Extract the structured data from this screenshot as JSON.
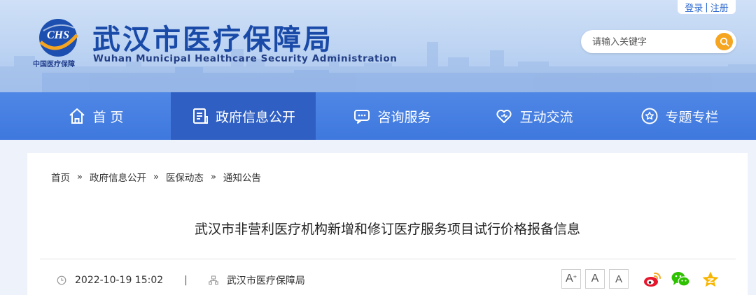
{
  "header": {
    "logo_caption": "中国医疗保障",
    "logo_text": "CHS",
    "title": "武汉市医疗保障局",
    "subtitle": "Wuhan Municipal Healthcare Security Administration",
    "login_label": "登录",
    "login_separator": "|",
    "register_label": "注册",
    "search_placeholder": "请输入关键字"
  },
  "nav": {
    "items": [
      {
        "label": "首 页",
        "icon": "home-icon"
      },
      {
        "label": "政府信息公开",
        "icon": "document-icon",
        "active": true
      },
      {
        "label": "咨询服务",
        "icon": "chat-icon"
      },
      {
        "label": "互动交流",
        "icon": "heart-icon"
      },
      {
        "label": "专题专栏",
        "icon": "star-icon"
      }
    ]
  },
  "breadcrumb": {
    "items": [
      "首页",
      "政府信息公开",
      "医保动态",
      "通知公告"
    ],
    "separator": "»"
  },
  "article": {
    "title": "武汉市非营利医疗机构新增和修订医疗服务项目试行价格报备信息",
    "date": "2022-10-19 15:02",
    "divider": "|",
    "source": "武汉市医疗保障局"
  },
  "tools": {
    "font_large": "A",
    "font_large_sup": "+",
    "font_medium": "A",
    "font_small": "A",
    "share": [
      "weibo-icon",
      "wechat-icon",
      "qzone-icon"
    ]
  },
  "colors": {
    "brand_blue": "#1a4aa8",
    "nav_blue": "#4a82e4",
    "nav_active": "#2f5fc2",
    "search_orange": "#f5a51f",
    "weibo_red": "#e6162d",
    "wechat_green": "#2dc100",
    "qzone_yellow": "#f7b500"
  }
}
